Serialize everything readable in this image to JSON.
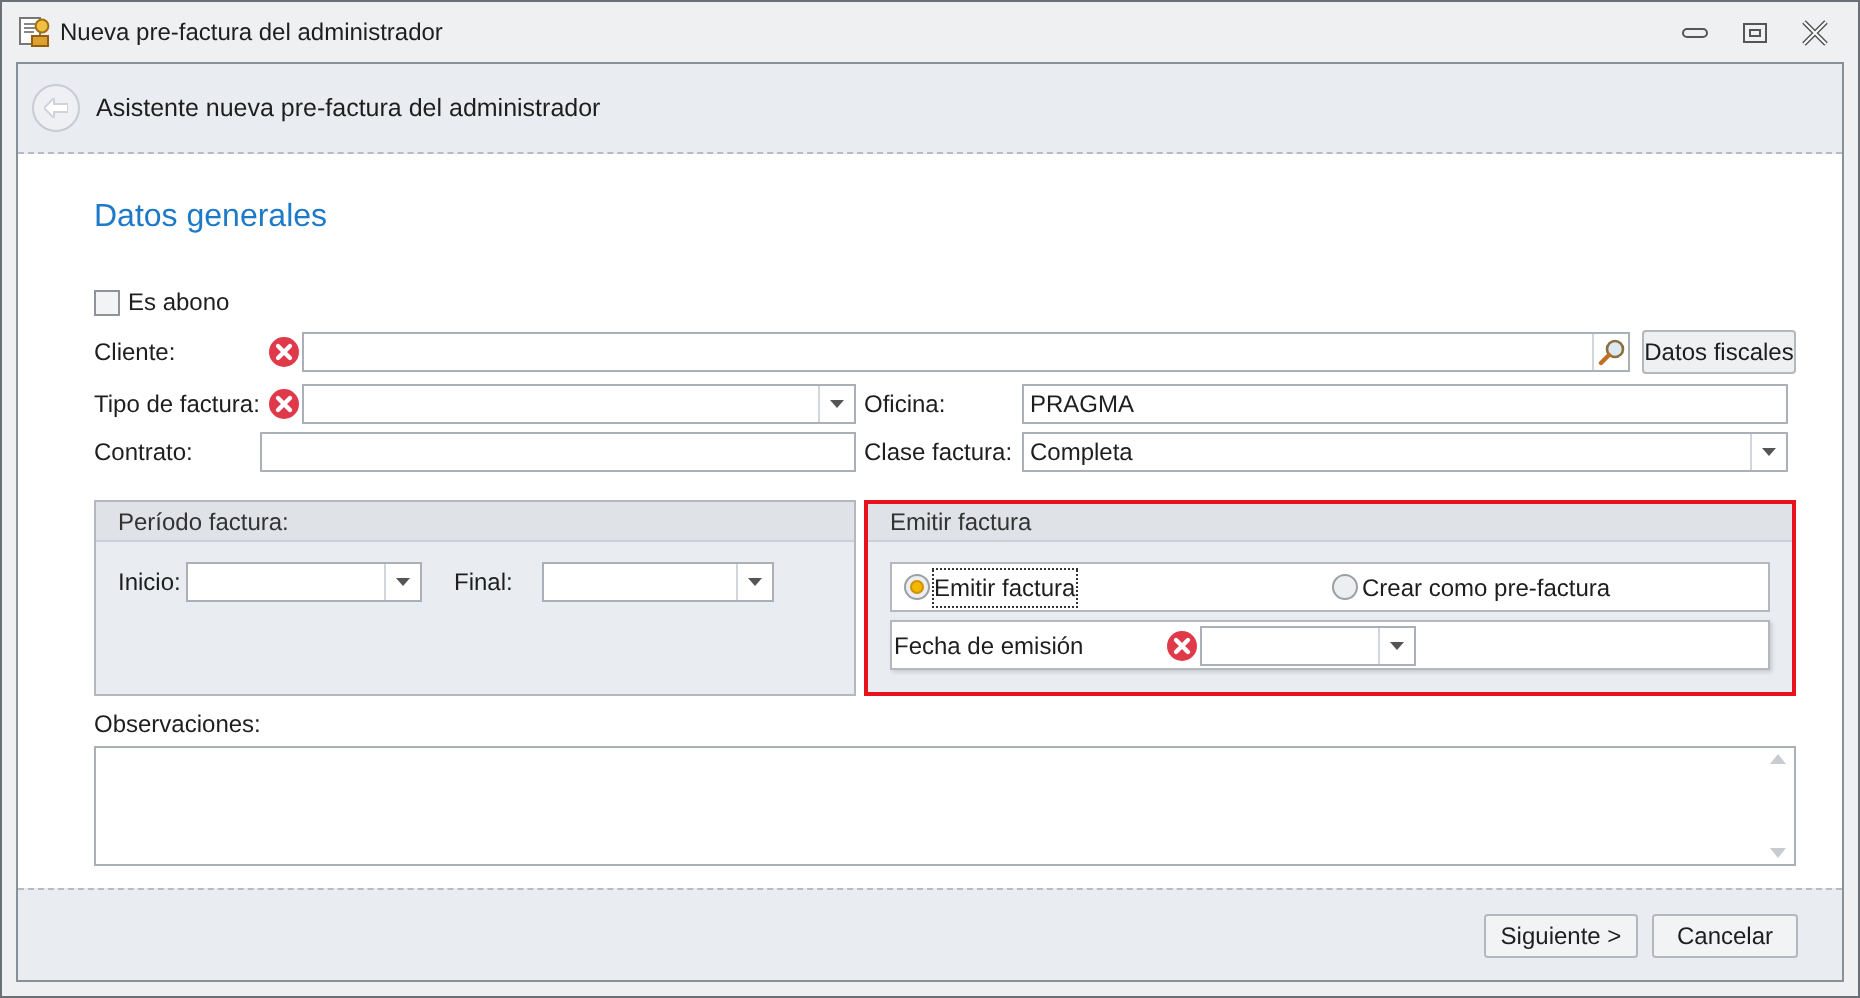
{
  "window": {
    "title": "Nueva pre-factura del administrador"
  },
  "wizard": {
    "title": "Asistente nueva pre-factura del administrador"
  },
  "section_title": "Datos generales",
  "es_abono": {
    "label": "Es abono",
    "checked": false
  },
  "cliente": {
    "label": "Cliente:",
    "required": true
  },
  "datos_fiscales_button": "Datos fiscales",
  "tipo_factura": {
    "label": "Tipo de factura:",
    "required": true
  },
  "oficina": {
    "label": "Oficina:",
    "value": "PRAGMA"
  },
  "contrato": {
    "label": "Contrato:"
  },
  "clase_factura": {
    "label": "Clase factura:",
    "value": "Completa"
  },
  "periodo": {
    "title": "Período factura:",
    "inicio_label": "Inicio:",
    "final_label": "Final:"
  },
  "emitir": {
    "title": "Emitir factura",
    "highlighted": true,
    "options": [
      {
        "label": "Emitir factura",
        "selected": true
      },
      {
        "label": "Crear como pre-factura",
        "selected": false
      }
    ],
    "fecha": {
      "label": "Fecha de emisión",
      "required": true
    }
  },
  "observaciones": {
    "label": "Observaciones:"
  },
  "buttons": [
    "Siguiente >",
    "Cancelar"
  ]
}
